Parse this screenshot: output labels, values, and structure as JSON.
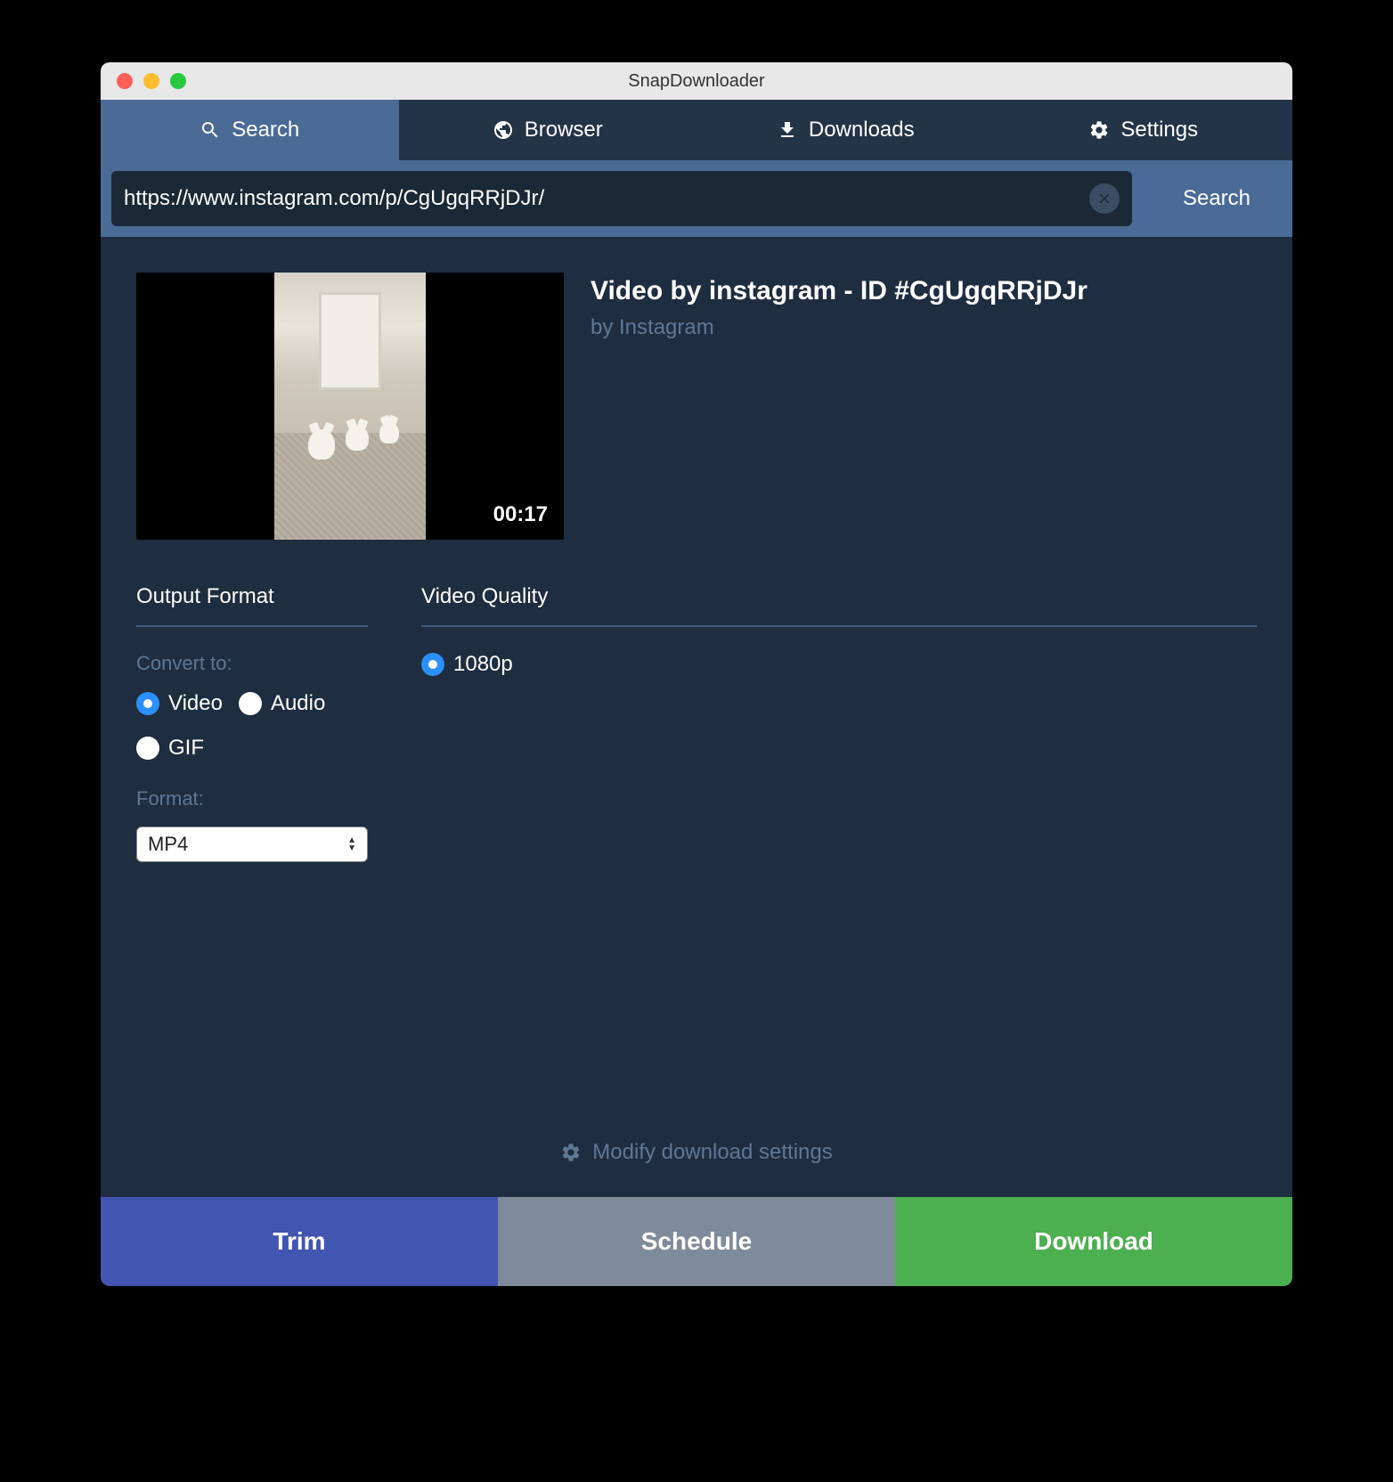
{
  "window": {
    "title": "SnapDownloader"
  },
  "tabs": {
    "search": "Search",
    "browser": "Browser",
    "downloads": "Downloads",
    "settings": "Settings"
  },
  "searchbar": {
    "value": "https://www.instagram.com/p/CgUgqRRjDJr/",
    "button": "Search"
  },
  "video": {
    "title": "Video by instagram - ID #CgUgqRRjDJr",
    "author": "by Instagram",
    "duration": "00:17"
  },
  "output": {
    "header": "Output Format",
    "convert_label": "Convert to:",
    "video": "Video",
    "audio": "Audio",
    "gif": "GIF",
    "format_label": "Format:",
    "format_value": "MP4"
  },
  "quality": {
    "header": "Video Quality",
    "option": "1080p"
  },
  "modify": "Modify download settings",
  "actions": {
    "trim": "Trim",
    "schedule": "Schedule",
    "download": "Download"
  }
}
